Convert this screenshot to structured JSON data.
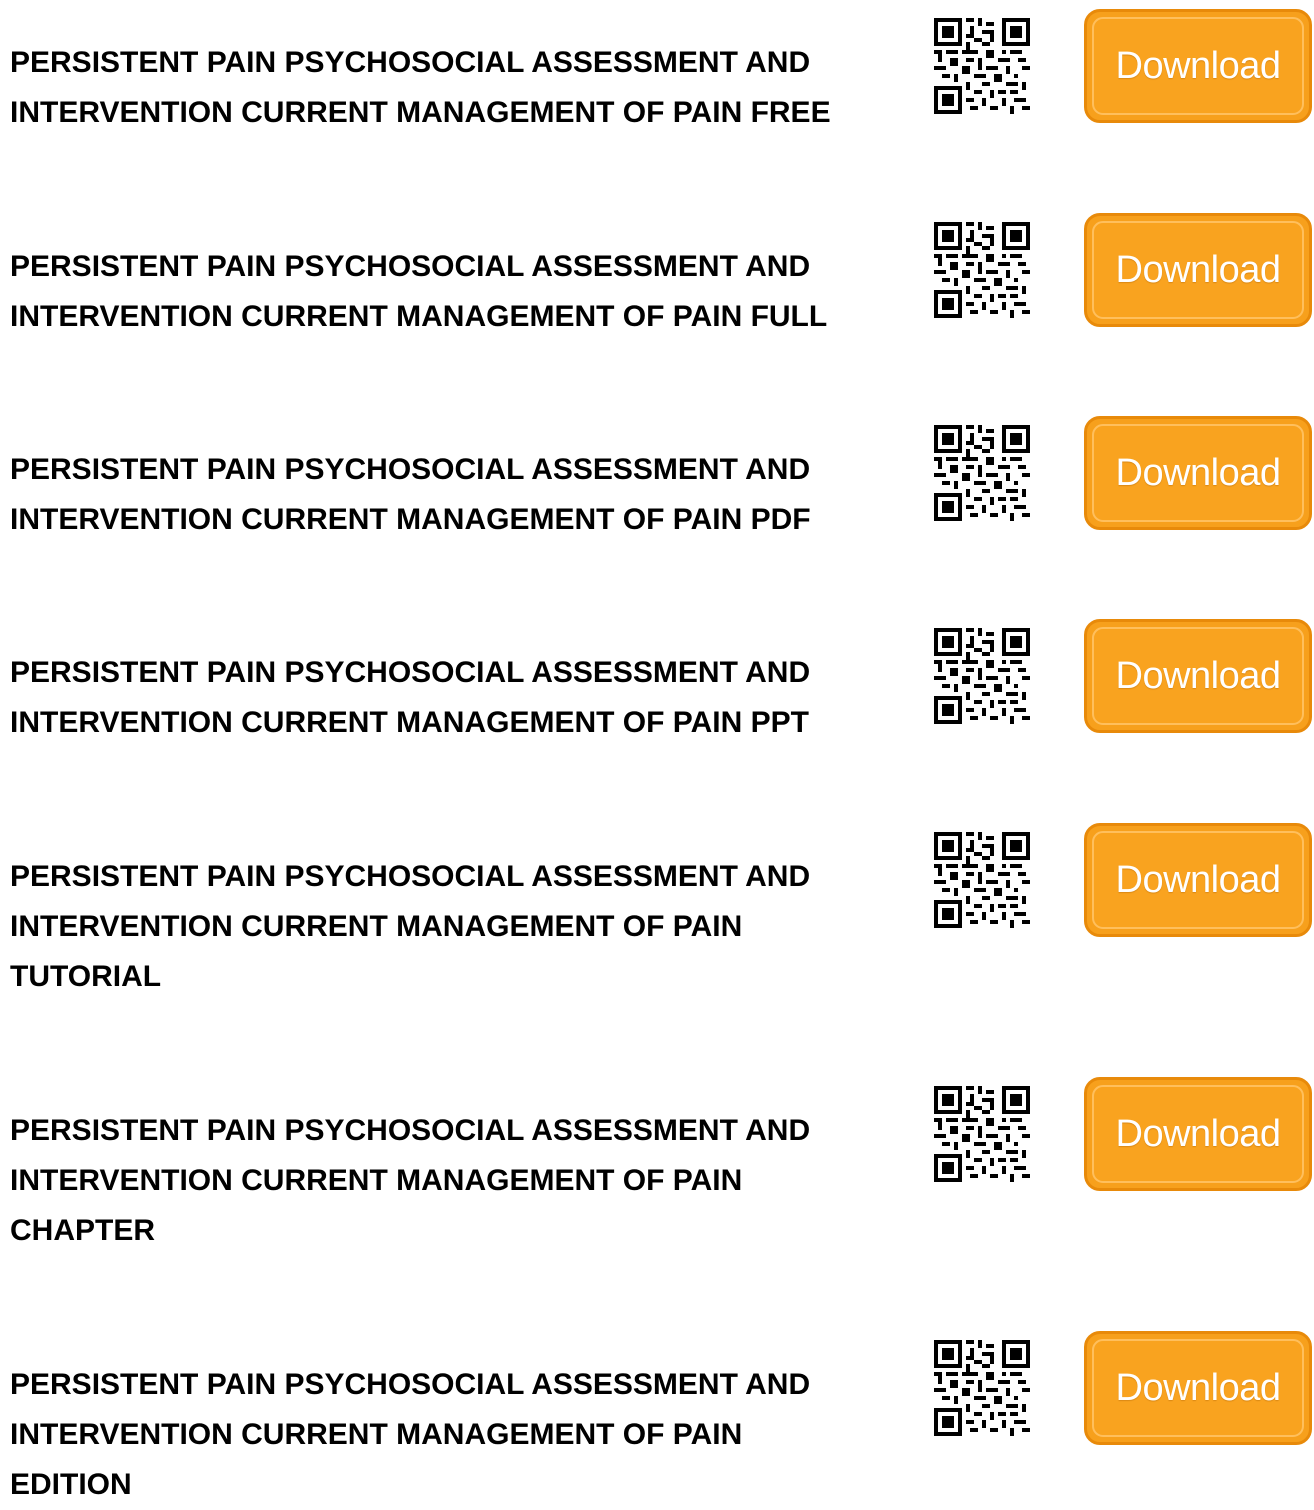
{
  "colors": {
    "button_bg": "#f7a01c",
    "button_border": "#e88a0a",
    "button_text": "#ffffff",
    "title_text": "#000000"
  },
  "items": [
    {
      "title_lines": [
        "PERSISTENT PAIN PSYCHOSOCIAL ASSESSMENT AND",
        "INTERVENTION CURRENT MANAGEMENT OF PAIN FREE"
      ],
      "qr_icon": "qr-code-icon",
      "download_label": "Download"
    },
    {
      "title_lines": [
        "PERSISTENT PAIN PSYCHOSOCIAL ASSESSMENT AND",
        "INTERVENTION CURRENT MANAGEMENT OF PAIN FULL"
      ],
      "qr_icon": "qr-code-icon",
      "download_label": "Download"
    },
    {
      "title_lines": [
        "PERSISTENT PAIN PSYCHOSOCIAL ASSESSMENT AND",
        "INTERVENTION CURRENT MANAGEMENT OF PAIN PDF"
      ],
      "qr_icon": "qr-code-icon",
      "download_label": "Download"
    },
    {
      "title_lines": [
        "PERSISTENT PAIN PSYCHOSOCIAL ASSESSMENT AND",
        "INTERVENTION CURRENT MANAGEMENT OF PAIN PPT"
      ],
      "qr_icon": "qr-code-icon",
      "download_label": "Download"
    },
    {
      "title_lines": [
        "PERSISTENT PAIN PSYCHOSOCIAL ASSESSMENT AND",
        "INTERVENTION CURRENT MANAGEMENT OF PAIN",
        "TUTORIAL"
      ],
      "qr_icon": "qr-code-icon",
      "download_label": "Download"
    },
    {
      "title_lines": [
        "PERSISTENT PAIN PSYCHOSOCIAL ASSESSMENT AND",
        "INTERVENTION CURRENT MANAGEMENT OF PAIN",
        "CHAPTER"
      ],
      "qr_icon": "qr-code-icon",
      "download_label": "Download"
    },
    {
      "title_lines": [
        "PERSISTENT PAIN PSYCHOSOCIAL ASSESSMENT AND",
        "INTERVENTION CURRENT MANAGEMENT OF PAIN",
        "EDITION"
      ],
      "qr_icon": "qr-code-icon",
      "download_label": "Download"
    }
  ]
}
